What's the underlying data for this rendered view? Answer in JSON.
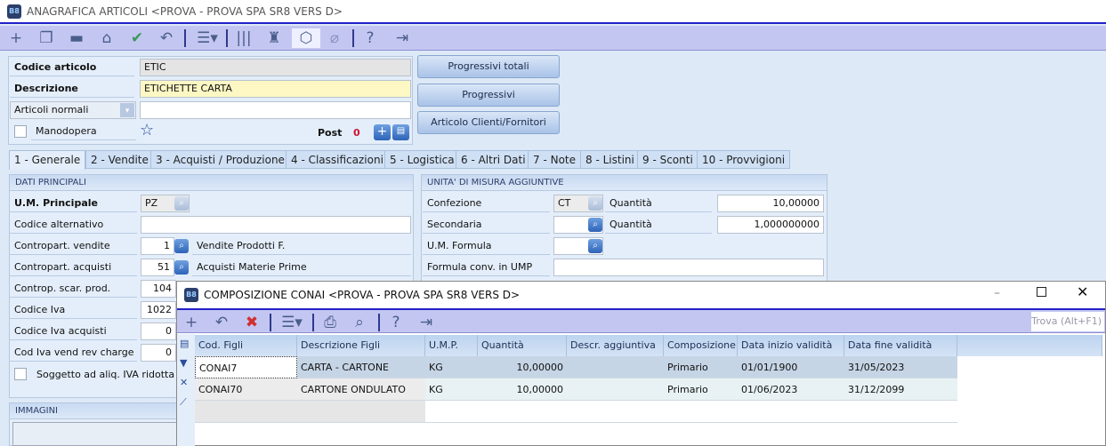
{
  "window": {
    "title": "ANAGRAFICA ARTICOLI <PROVA - PROVA SPA SR8 VERS D>",
    "icon": "B8"
  },
  "toolbar": [
    "add-icon",
    "copy-icon",
    "folder-icon",
    "save-icon",
    "confirm-check-icon",
    "undo-icon",
    "menu-icon",
    "barcode-icon",
    "basket-icon",
    "package-icon",
    "attach-icon",
    "help-icon",
    "exit-icon"
  ],
  "header": {
    "codice_label": "Codice articolo",
    "codice_value": "ETIC",
    "descrizione_label": "Descrizione",
    "descrizione_value": "ETICHETTE CARTA",
    "tipo_value": "Articoli normali",
    "tipo_extra": "",
    "manodopera_label": "Manodopera",
    "post_label": "Post",
    "post_count": "0"
  },
  "buttons": {
    "progressivi_totali": "Progressivi totali",
    "progressivi": "Progressivi",
    "clienti_fornitori": "Articolo Clienti/Fornitori"
  },
  "tabs": [
    "1 - Generale",
    "2 - Vendite",
    "3 - Acquisti / Produzione",
    "4 - Classificazioni",
    "5 - Logistica",
    "6 - Altri Dati",
    "7 - Note",
    "8 - Listini",
    "9 - Sconti",
    "10 - Provvigioni"
  ],
  "dati": {
    "title": "DATI PRINCIPALI",
    "um_label": "U.M. Principale",
    "um_value": "PZ",
    "alt_label": "Codice alternativo",
    "alt_value": "",
    "cv_label": "Contropart. vendite",
    "cv_value": "1",
    "cv_desc": "Vendite Prodotti F.",
    "ca_label": "Contropart. acquisti",
    "ca_value": "51",
    "ca_desc": "Acquisti Materie Prime",
    "csp_label": "Controp. scar. prod.",
    "csp_value": "104",
    "iva_label": "Codice Iva",
    "iva_value": "1022",
    "ivaa_label": "Codice Iva acquisti",
    "ivaa_value": "0",
    "ivarc_label": "Cod Iva vend rev charge",
    "ivarc_value": "0",
    "ridotta_label": "Soggetto ad aliq. IVA ridotta"
  },
  "immagini": {
    "title": "IMMAGINI"
  },
  "unita": {
    "title": "UNITA' DI MISURA AGGIUNTIVE",
    "conf_label": "Confezione",
    "conf_value": "CT",
    "q1_label": "Quantità",
    "q1_value": "10,00000",
    "sec_label": "Secondaria",
    "sec_value": "",
    "q2_label": "Quantità",
    "q2_value": "1,000000000",
    "umf_label": "U.M. Formula",
    "umf_value": "",
    "form_label": "Formula conv. in UMP",
    "form_value": ""
  },
  "dialog": {
    "title": "COMPOSIZIONE CONAI <PROVA - PROVA SPA SR8 VERS D>",
    "trova": "Trova (Alt+F1)",
    "columns": [
      "Cod. Figli",
      "Descrizione Figli",
      "U.M.P.",
      "Quantità",
      "Descr. aggiuntiva",
      "Composizione",
      "Data inizio validità",
      "Data fine validità"
    ],
    "rows": [
      [
        "CONAI7",
        "CARTA - CARTONE",
        "KG",
        "10,00000",
        "",
        "Primario",
        "01/01/1900",
        "31/05/2023"
      ],
      [
        "CONAI70",
        "CARTONE ONDULATO",
        "KG",
        "10,00000",
        "",
        "Primario",
        "01/06/2023",
        "31/12/2099"
      ]
    ]
  }
}
